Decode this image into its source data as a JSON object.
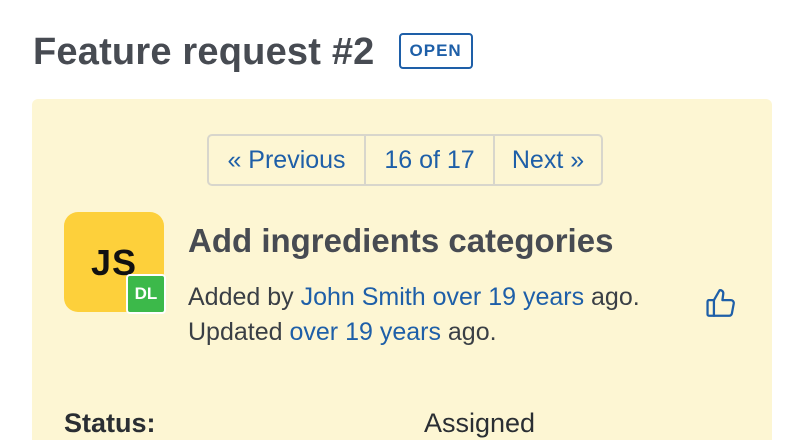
{
  "header": {
    "title": "Feature request #2",
    "badge": "OPEN"
  },
  "pager": {
    "previous_label": "« Previous",
    "position": "16 of 17",
    "next_label": "Next »"
  },
  "issue": {
    "avatar_initials": "JS",
    "avatar_sub_initials": "DL",
    "title": "Add ingredients categories",
    "added_by_prefix": "Added by",
    "author": "John Smith",
    "added_time": "over 19 years",
    "added_suffix": "ago.",
    "updated_prefix": "Updated",
    "updated_time": "over 19 years",
    "updated_suffix": "ago."
  },
  "attributes": {
    "status_label": "Status:",
    "status_value": "Assigned"
  },
  "colors": {
    "link": "#1e5fa8",
    "panel_bg": "#fdf6d3",
    "avatar_bg": "#fdd03b",
    "sub_avatar_bg": "#3cb94a"
  },
  "icons": {
    "vote": "thumbs-up-icon"
  }
}
